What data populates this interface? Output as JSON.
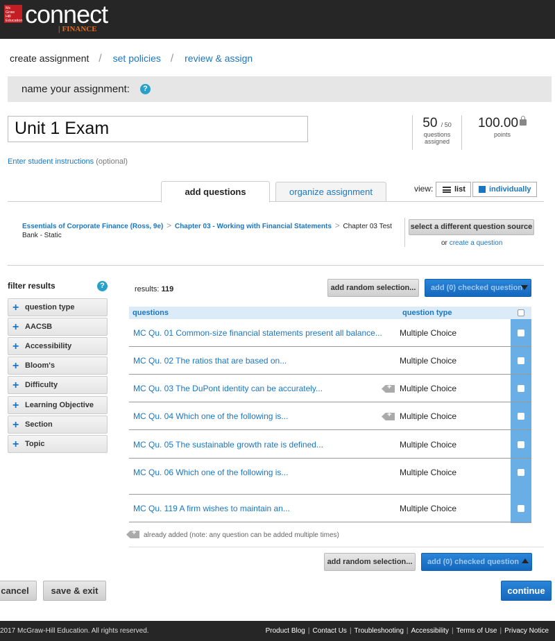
{
  "brand": {
    "logo_box_text": "Mc\nGraw\nHill\nEducation",
    "product": "connect",
    "subproduct": "FINANCE"
  },
  "steps": [
    {
      "label": "create assignment",
      "active": true
    },
    {
      "label": "set policies",
      "active": false
    },
    {
      "label": "review & assign",
      "active": false
    }
  ],
  "name_section": {
    "label": "name your assignment:",
    "title_value": "Unit 1 Exam",
    "instructions_link": "Enter student instructions",
    "instructions_optional": "(optional)"
  },
  "stats": {
    "questions_count": "50",
    "questions_total": "/ 50",
    "questions_label_1": "questions",
    "questions_label_2": "assigned",
    "points": "100.00",
    "points_label": "points"
  },
  "tabs": {
    "add": "add questions",
    "organize": "organize assignment"
  },
  "view": {
    "label": "view:",
    "list": "list",
    "individually": "individually"
  },
  "source": {
    "crumb_1": "Essentials of Corporate Finance (Ross, 9e)",
    "crumb_2": "Chapter 03 - Working with Financial Statements",
    "crumb_3": "Chapter 03 Test Bank - Static",
    "select_source_button": "select a different question source",
    "or": "or",
    "create_question": "create a question"
  },
  "filters": {
    "title": "filter results",
    "items": [
      "question type",
      "AACSB",
      "Accessibility",
      "Bloom's",
      "Difficulty",
      "Learning Objective",
      "Section",
      "Topic"
    ]
  },
  "results": {
    "label": "results:",
    "count": "119",
    "random_button": "add random selection...",
    "add_checked_button": "add (0) checked question"
  },
  "table": {
    "col_questions": "questions",
    "col_type": "question type",
    "rows": [
      {
        "title": "MC Qu. 01 Common-size financial statements present all balance...",
        "type": "Multiple Choice",
        "added": false
      },
      {
        "title": "MC Qu. 02 The ratios that are based on...",
        "type": "Multiple Choice",
        "added": false
      },
      {
        "title": "MC Qu. 03 The DuPont identity can be accurately...",
        "type": "Multiple Choice",
        "added": true
      },
      {
        "title": "MC Qu. 04 Which one of the following is...",
        "type": "Multiple Choice",
        "added": true
      },
      {
        "title": "MC Qu. 05 The sustainable growth rate is defined...",
        "type": "Multiple Choice",
        "added": false
      },
      {
        "title": "MC Qu. 06 Which one of the following is...",
        "type": "Multiple Choice",
        "added": false
      },
      {
        "title": "MC Qu. 119 A firm wishes to maintain an...",
        "type": "Multiple Choice",
        "added": false
      }
    ]
  },
  "legend": "already added (note: any question can be added multiple times)",
  "actions": {
    "cancel": "cancel",
    "save_exit": "save & exit",
    "continue": "continue"
  },
  "footer": {
    "copyright": "2017 McGraw-Hill Education. All rights reserved.",
    "links": [
      "Product Blog",
      "Contact Us",
      "Troubleshooting",
      "Accessibility",
      "Terms of Use",
      "Privacy Notice"
    ]
  },
  "colors": {
    "brand_red": "#c41e24",
    "link_blue": "#1b76c2",
    "button_blue": "#1468bd",
    "finance_orange": "#e36c1e"
  }
}
